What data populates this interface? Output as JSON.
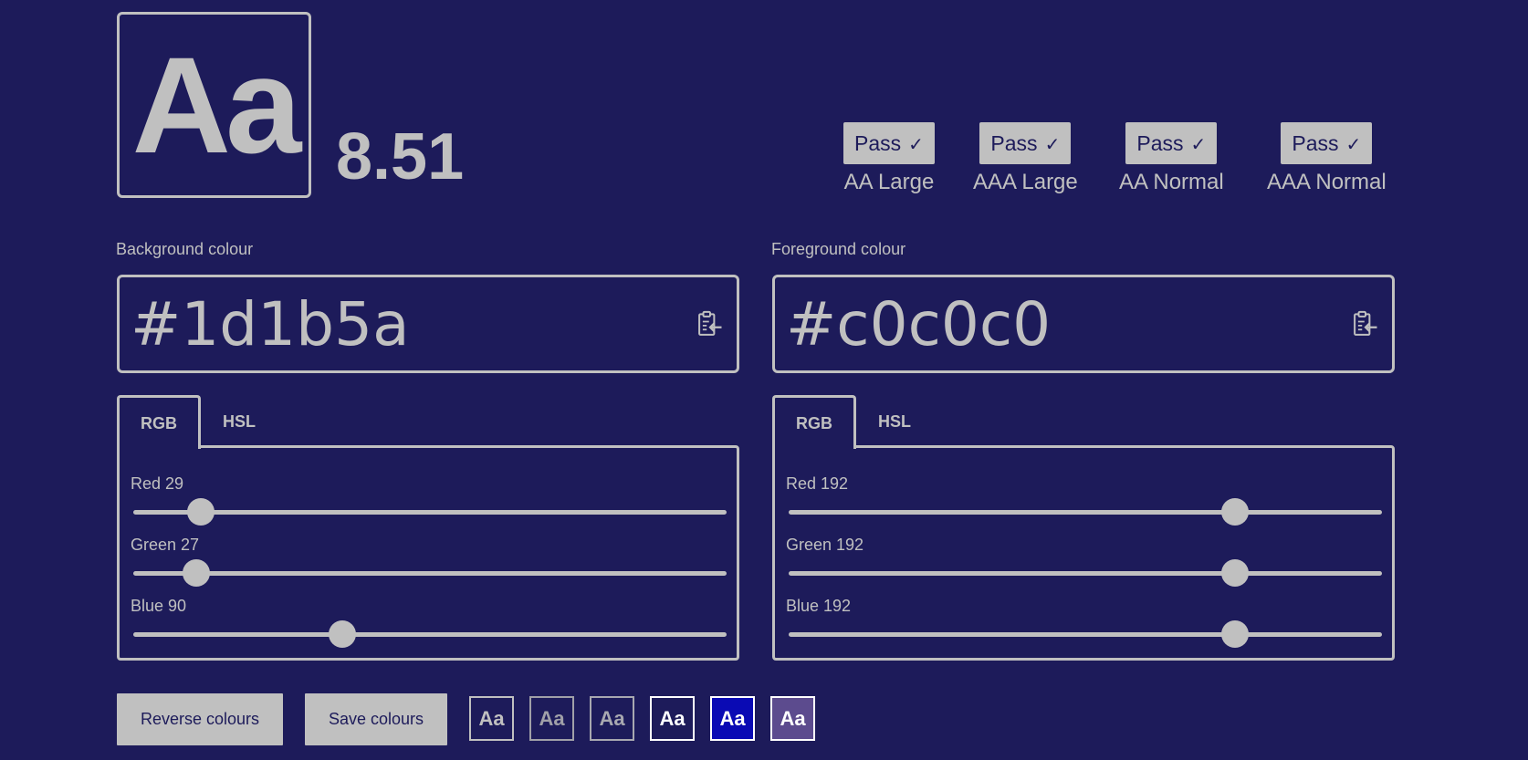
{
  "preview": {
    "sample": "Aa"
  },
  "ratio": "8.51",
  "results": [
    {
      "status": "Pass",
      "label": "AA Large"
    },
    {
      "status": "Pass",
      "label": "AAA Large"
    },
    {
      "status": "Pass",
      "label": "AA Normal"
    },
    {
      "status": "Pass",
      "label": "AAA Normal"
    }
  ],
  "background": {
    "label": "Background colour",
    "hex": "#1d1b5a",
    "tabs": [
      "RGB",
      "HSL"
    ],
    "sliders": [
      {
        "label": "Red 29",
        "value": 29,
        "max": 255
      },
      {
        "label": "Green 27",
        "value": 27,
        "max": 255
      },
      {
        "label": "Blue 90",
        "value": 90,
        "max": 255
      }
    ]
  },
  "foreground": {
    "label": "Foreground colour",
    "hex": "#c0c0c0",
    "tabs": [
      "RGB",
      "HSL"
    ],
    "sliders": [
      {
        "label": "Red 192",
        "value": 192,
        "max": 255
      },
      {
        "label": "Green 192",
        "value": 192,
        "max": 255
      },
      {
        "label": "Blue 192",
        "value": 192,
        "max": 255
      }
    ]
  },
  "buttons": {
    "reverse": "Reverse colours",
    "save": "Save colours"
  },
  "swatches": [
    {
      "text": "Aa",
      "bg": "#1d1b5a",
      "fg": "#c0c0c0"
    },
    {
      "text": "Aa",
      "bg": "#1d1b5a",
      "fg": "#a0a0a8"
    },
    {
      "text": "Aa",
      "bg": "#1d1b5a",
      "fg": "#a8a8b0"
    },
    {
      "text": "Aa",
      "bg": "#1d1b5a",
      "fg": "#ffffff"
    },
    {
      "text": "Aa",
      "bg": "#0a0ab4",
      "fg": "#ffffff"
    },
    {
      "text": "Aa",
      "bg": "#5c4b8e",
      "fg": "#ffffff"
    }
  ],
  "colors": {
    "background": "#1d1b5a",
    "foreground": "#c0c0c0"
  },
  "icons": {
    "check": "check-icon",
    "paste": "paste-icon"
  }
}
